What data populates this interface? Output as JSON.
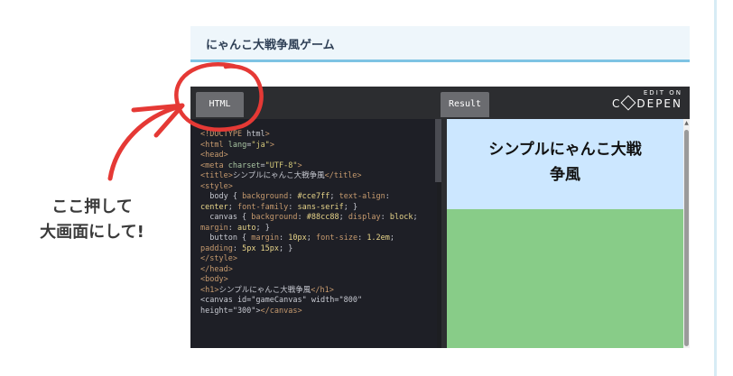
{
  "article": {
    "title": "にゃんこ大戦争風ゲーム"
  },
  "embed": {
    "tabs": {
      "html": "HTML",
      "result": "Result"
    },
    "edit_on": "EDIT ON",
    "brand_prefix": "C",
    "brand_suffix": "DEPEN",
    "code_lines": [
      "<!DOCTYPE html>",
      "<html lang=\"ja\">",
      "<head>",
      "<meta charset=\"UTF-8\">",
      "<title>シンプルにゃんこ大戦争風</title>",
      "<style>",
      "  body { background: #cce7ff; text-align:",
      "center; font-family: sans-serif; }",
      "  canvas { background: #88cc88; display: block;",
      "margin: auto; }",
      "  button { margin: 10px; font-size: 1.2em;",
      "padding: 5px 15px; }",
      "</style>",
      "</head>",
      "<body>",
      "<h1>シンプルにゃんこ大戦争風</h1>",
      "<canvas id=\"gameCanvas\" width=\"800\"",
      "height=\"300\"></canvas>"
    ],
    "result": {
      "heading_line1": "シンプルにゃんこ大戦",
      "heading_line2": "争風",
      "bg_color": "#cce7ff",
      "canvas_color": "#88cc88"
    }
  },
  "annotation": {
    "line1": "ここ押して",
    "line2": "大画面にして!",
    "color": "#e53935"
  }
}
